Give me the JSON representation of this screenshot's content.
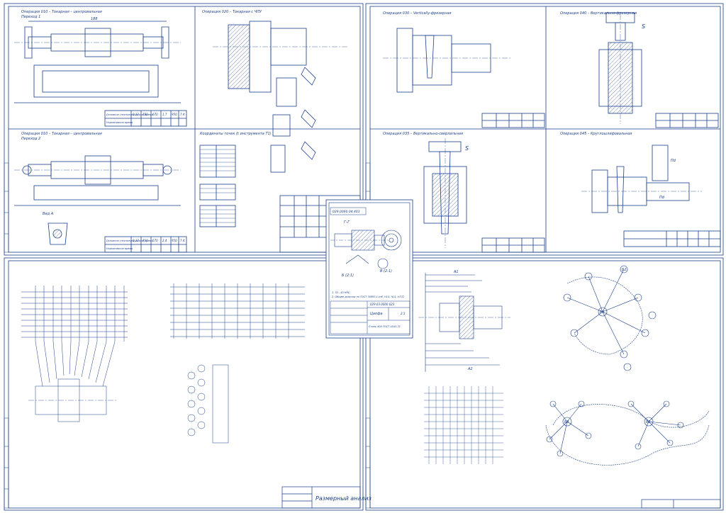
{
  "sheets": {
    "top_left": {
      "title_op010_a": "Операция 010 – Токарная – центровальная",
      "subtitle_a": "Переход 1",
      "title_op010_b": "Операция 010 – Токарная – центровальная",
      "subtitle_b": "Переход 2",
      "title_op020": "Операция 020 – Токарная с ЧПУ",
      "view_a": "Вид А",
      "coords_label": "Координаты точек (t инструмента Т1)",
      "table_a_rows": [
        "Основное (технологическое) время",
        "Нормативное время"
      ],
      "table_a_vals": [
        "0,12",
        "780",
        "670",
        "1,7",
        "950",
        "7,4"
      ],
      "table_b_rows": [
        "Основное (технологическое) время",
        "Нормативное время"
      ],
      "table_b_vals": [
        "0,12",
        "710",
        "570",
        "2,4",
        "950",
        "7,4"
      ]
    },
    "top_right": {
      "title_op030": "Операция 030 – Vertically-фрезерная",
      "title_op040": "Операция 040 – Вертикально-фрезерная",
      "title_op035": "Операция 035 – Вертикально-сверлильная",
      "title_op045": "Операция 045 – Круглошлифовальная",
      "labels": [
        "S",
        "S",
        "Пd",
        "Пd"
      ]
    },
    "center_part": {
      "drawing_no": "029.0060.04.403",
      "section_label": "Г–Г",
      "view_b": "Б (2:1)",
      "view_v": "В (2:1)",
      "notes": [
        "1. 32...40 HRC",
        "2. Общие допуски по ГОСТ 30893.1-mK, H14, h14, ±IT/2"
      ],
      "stamp_code": "029.03.0000.623",
      "stamp_name": "Цапфа",
      "stamp_material": "Сталь 40Х ГОСТ 4543-71",
      "stamp_scale": "2:1"
    },
    "bottom_left": {
      "stamp_title": "Размерный анализ"
    },
    "bottom_right": {
      "labels": [
        "A1",
        "A2",
        "A3",
        "A4",
        "Б1",
        "Б2",
        "Б3",
        "В1"
      ]
    }
  }
}
